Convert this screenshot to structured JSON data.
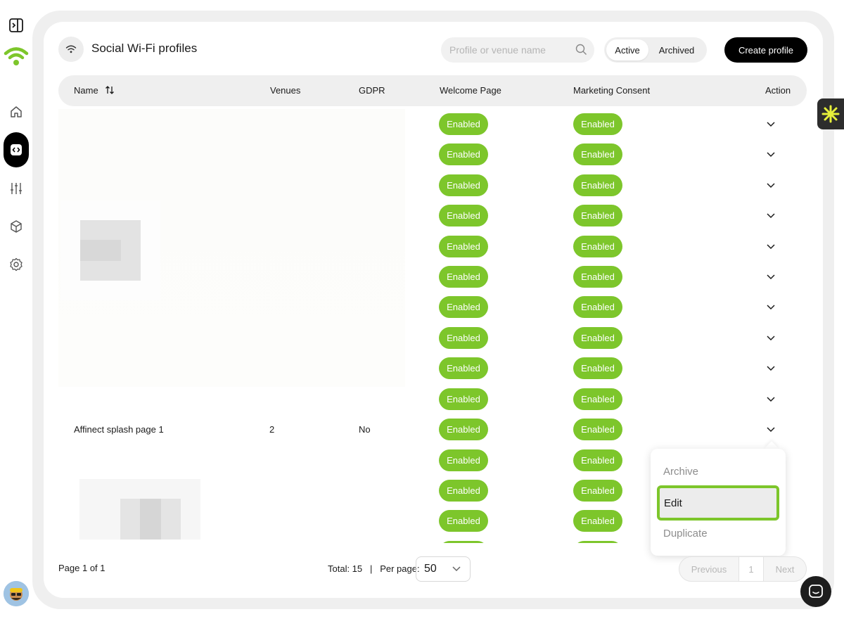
{
  "header": {
    "title": "Social Wi-Fi profiles",
    "search_placeholder": "Profile or venue name",
    "toggle_active": "Active",
    "toggle_archived": "Archived",
    "create_label": "Create profile"
  },
  "table": {
    "columns": [
      "Name",
      "Venues",
      "GDPR",
      "Welcome Page",
      "Marketing Consent",
      "Action"
    ],
    "pill_label": "Enabled",
    "visible_row": {
      "name": "Affinect splash page 1",
      "venues": "2",
      "gdpr": "No"
    }
  },
  "menu": {
    "items": [
      "Archive",
      "Edit",
      "Duplicate"
    ]
  },
  "footer": {
    "page_text": "Page 1 of 1",
    "total_text": "Total: 15   |   Per page:",
    "per_page": "50",
    "prev": "Previous",
    "page_num": "1",
    "next": "Next"
  },
  "colors": {
    "accent_green": "#7dc62b",
    "primary_black": "#000000",
    "frame_gray": "#efefef"
  },
  "icons": [
    "sidebar-toggle-icon",
    "wifi-logo-icon",
    "home-icon",
    "code-icon",
    "sliders-icon",
    "cube-icon",
    "gear-icon",
    "wifi-icon",
    "search-icon",
    "sort-icon",
    "chevron-down-icon",
    "chat-icon",
    "sparkle-icon"
  ]
}
